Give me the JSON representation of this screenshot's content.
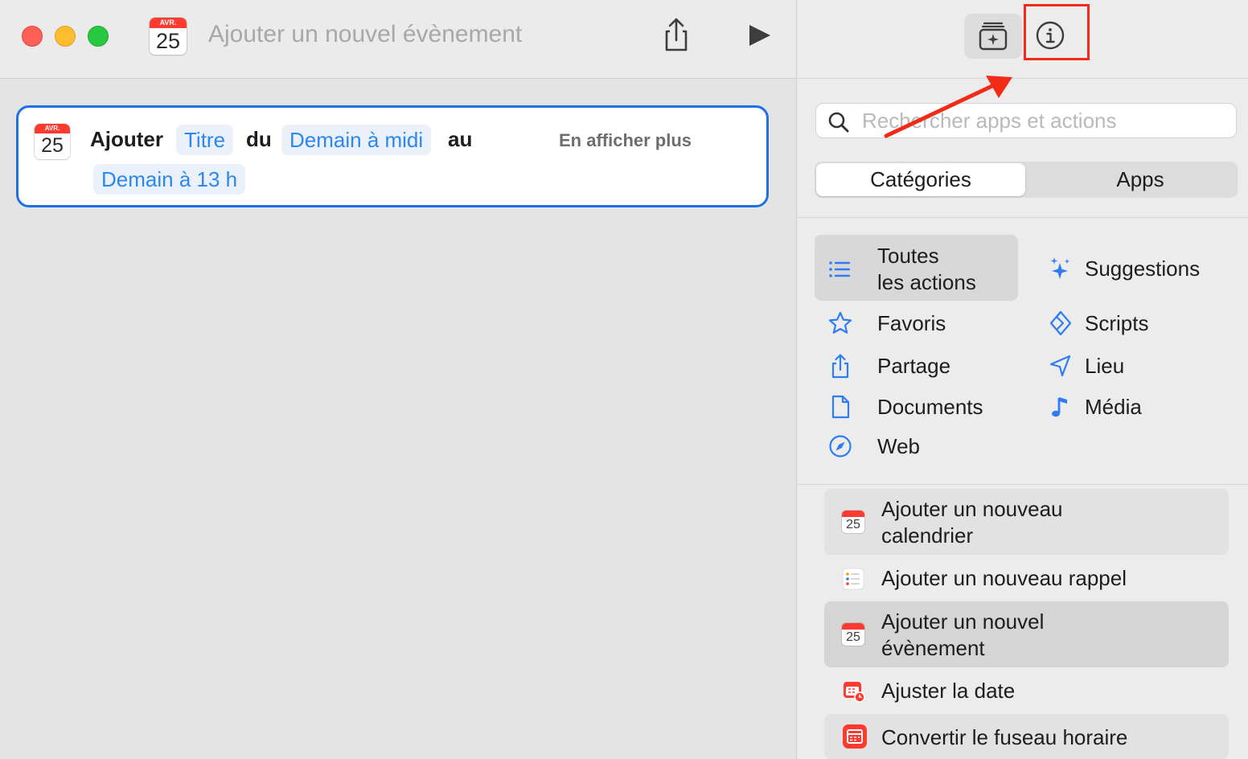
{
  "window": {
    "title": "Ajouter un nouvel évènement",
    "calendar_icon": {
      "month": "AVR.",
      "day": "25"
    }
  },
  "action_card": {
    "calendar_icon": {
      "month": "AVR.",
      "day": "25"
    },
    "word_add": "Ajouter",
    "token_title": "Titre",
    "word_from": "du",
    "token_start": "Demain à midi",
    "word_to": "au",
    "token_end": "Demain à 13 h",
    "show_more": "En afficher plus"
  },
  "sidebar": {
    "search": {
      "placeholder": "Rechercher apps et actions",
      "value": ""
    },
    "segments": {
      "categories": "Catégories",
      "apps": "Apps"
    },
    "categories_left": [
      {
        "label_line1": "Toutes",
        "label_line2": "les actions",
        "icon": "list-icon"
      },
      {
        "label": "Favoris",
        "icon": "star-icon"
      },
      {
        "label": "Partage",
        "icon": "share-icon"
      },
      {
        "label": "Documents",
        "icon": "document-icon"
      },
      {
        "label": "Web",
        "icon": "compass-icon"
      }
    ],
    "categories_right": [
      {
        "label": "Suggestions",
        "icon": "sparkles-icon"
      },
      {
        "label": "Scripts",
        "icon": "script-icon"
      },
      {
        "label": "Lieu",
        "icon": "location-icon"
      },
      {
        "label": "Média",
        "icon": "music-note-icon"
      }
    ],
    "actions": [
      {
        "label_line1": "Ajouter un nouveau",
        "label_line2": "calendrier",
        "icon": "calendar-icon",
        "day": "25"
      },
      {
        "label": "Ajouter un nouveau rappel",
        "icon": "reminders-icon"
      },
      {
        "label_line1": "Ajouter un nouvel",
        "label_line2": "évènement",
        "icon": "calendar-icon",
        "day": "25"
      },
      {
        "label": "Ajuster la date",
        "icon": "adjust-date-icon"
      },
      {
        "label": "Convertir le fuseau horaire",
        "icon": "timezone-icon"
      }
    ]
  },
  "colors": {
    "accent": "#1f6fe5",
    "token_text": "#2d87f0",
    "highlight_red": "#f12b17",
    "calendar_red": "#ff3b30",
    "category_icon_blue": "#2f7df6"
  }
}
